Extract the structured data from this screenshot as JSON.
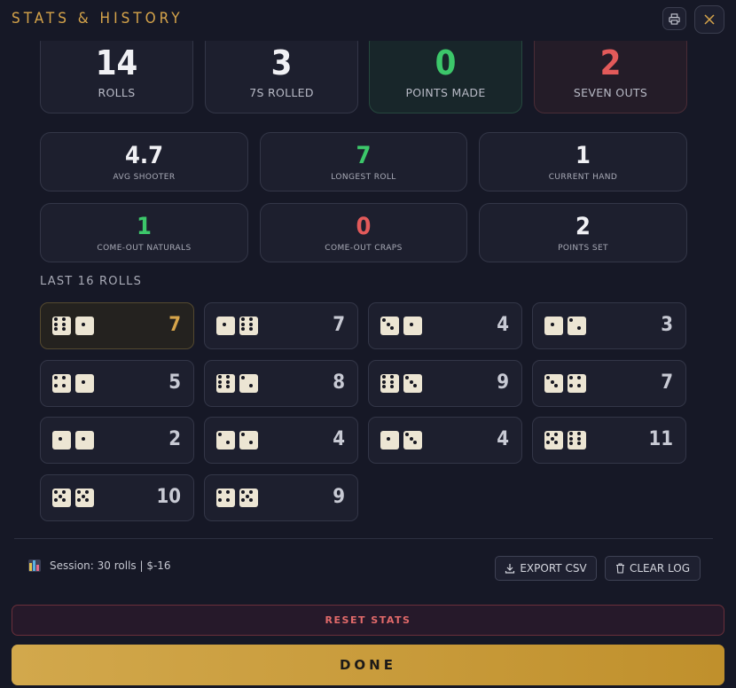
{
  "header": {
    "title": "STATS & HISTORY"
  },
  "top_stats": [
    {
      "value": "14",
      "label": "ROLLS",
      "color": "#f0f0f4"
    },
    {
      "value": "3",
      "label": "7S ROLLED",
      "color": "#f0f0f4"
    },
    {
      "value": "0",
      "label": "POINTS MADE",
      "color": "#3cc76a"
    },
    {
      "value": "2",
      "label": "SEVEN OUTS",
      "color": "#e25a5a"
    }
  ],
  "mid_stats": [
    {
      "value": "4.7",
      "label": "AVG SHOOTER",
      "color": "#f0f0f4"
    },
    {
      "value": "7",
      "label": "LONGEST ROLL",
      "color": "#3cc76a"
    },
    {
      "value": "1",
      "label": "CURRENT HAND",
      "color": "#f0f0f4"
    },
    {
      "value": "1",
      "label": "COME-OUT NATURALS",
      "color": "#3cc76a"
    },
    {
      "value": "0",
      "label": "COME-OUT CRAPS",
      "color": "#e25a5a"
    },
    {
      "value": "2",
      "label": "POINTS SET",
      "color": "#f0f0f4"
    }
  ],
  "history": {
    "label": "LAST 16 ROLLS",
    "rolls": [
      {
        "d1": 6,
        "d2": 1,
        "total": "7"
      },
      {
        "d1": 1,
        "d2": 6,
        "total": "7"
      },
      {
        "d1": 3,
        "d2": 1,
        "total": "4"
      },
      {
        "d1": 1,
        "d2": 2,
        "total": "3"
      },
      {
        "d1": 4,
        "d2": 1,
        "total": "5"
      },
      {
        "d1": 6,
        "d2": 2,
        "total": "8"
      },
      {
        "d1": 6,
        "d2": 3,
        "total": "9"
      },
      {
        "d1": 3,
        "d2": 4,
        "total": "7"
      },
      {
        "d1": 1,
        "d2": 1,
        "total": "2"
      },
      {
        "d1": 2,
        "d2": 2,
        "total": "4"
      },
      {
        "d1": 1,
        "d2": 3,
        "total": "4"
      },
      {
        "d1": 5,
        "d2": 6,
        "total": "11"
      },
      {
        "d1": 5,
        "d2": 5,
        "total": "10"
      },
      {
        "d1": 4,
        "d2": 5,
        "total": "9"
      }
    ]
  },
  "footer": {
    "session_text": "Session: 30 rolls | $-16",
    "export_label": "EXPORT CSV",
    "clear_label": "CLEAR LOG",
    "reset_label": "RESET STATS",
    "done_label": "DONE"
  },
  "colors": {
    "accent": "#d6a44a",
    "green": "#3cc76a",
    "red": "#e25a5a"
  }
}
